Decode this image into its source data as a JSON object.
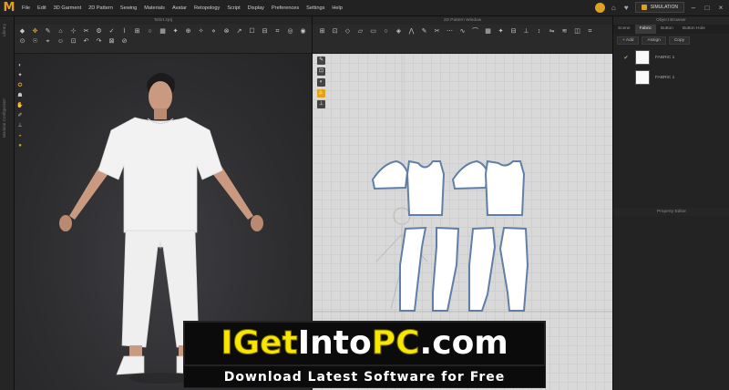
{
  "app": {
    "logo_letter": "M",
    "accent_color": "#e0a020"
  },
  "menu": {
    "items": [
      "File",
      "Edit",
      "3D Garment",
      "2D Pattern",
      "Sewing",
      "Materials",
      "Avatar",
      "Retopology",
      "Script",
      "Display",
      "Preferences",
      "Settings",
      "Help"
    ],
    "simulation_label": "SIMULATION"
  },
  "left_strip": {
    "labels": [
      "Library",
      "Modular Configurator"
    ]
  },
  "window_3d": {
    "title": "Tshirt.zprj"
  },
  "window_2d": {
    "title": "2D Pattern Window"
  },
  "object_browser": {
    "title": "Object Browser",
    "tabs": [
      "Scene",
      "Fabric",
      "Button",
      "Button Hole"
    ],
    "active_tab": "Fabric",
    "buttons": [
      "+ Add",
      "Assign",
      "Copy"
    ],
    "fabrics": [
      {
        "label": "FABRIC 1",
        "selected": true,
        "color": "#fafafa"
      },
      {
        "label": "FABRIC 1",
        "selected": false,
        "color": "#fafafa"
      }
    ]
  },
  "property_editor": {
    "title": "Property Editor"
  },
  "watermark": {
    "brand_parts": [
      {
        "text": "IGet",
        "color": "yellow"
      },
      {
        "text": "Into",
        "color": "white"
      },
      {
        "text": "PC",
        "color": "yellow"
      },
      {
        "text": ".com",
        "color": "white"
      }
    ],
    "tagline": "Download Latest Software for Free"
  }
}
